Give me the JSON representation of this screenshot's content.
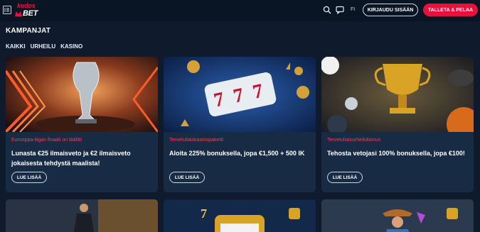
{
  "header": {
    "logo_top": "kudos",
    "logo_bottom": "BET",
    "lang": "FI",
    "login_label": "KIRJAUDU SISÄÄN",
    "deposit_label": "TALLETA & PELAA"
  },
  "page": {
    "title": "KAMPANJAT",
    "tabs": [
      {
        "label": "KAIKKI"
      },
      {
        "label": "URHEILU"
      },
      {
        "label": "KASINO"
      }
    ]
  },
  "cards": [
    {
      "tag": "Eurooppa-liigan finaali on täällä!",
      "title": "Lunasta €25 ilmaisveto ja €2 ilmaisveto jokaisesta tehdystä maalista!",
      "button": "LUE LISÄÄ"
    },
    {
      "tag": "Tervetuliaiskasinopaketti",
      "title": "Aloita 225% bonuksella, jopa €1,500 + 500 IK",
      "button": "LUE LISÄÄ"
    },
    {
      "tag": "Tervetuliaisurheilubonus",
      "title": "Tehosta vetojasi 100% bonuksella, jopa €100!",
      "button": "LUE LISÄÄ"
    }
  ],
  "colors": {
    "accent": "#e8113c",
    "background": "#0f1b2d",
    "card": "#172b45"
  }
}
